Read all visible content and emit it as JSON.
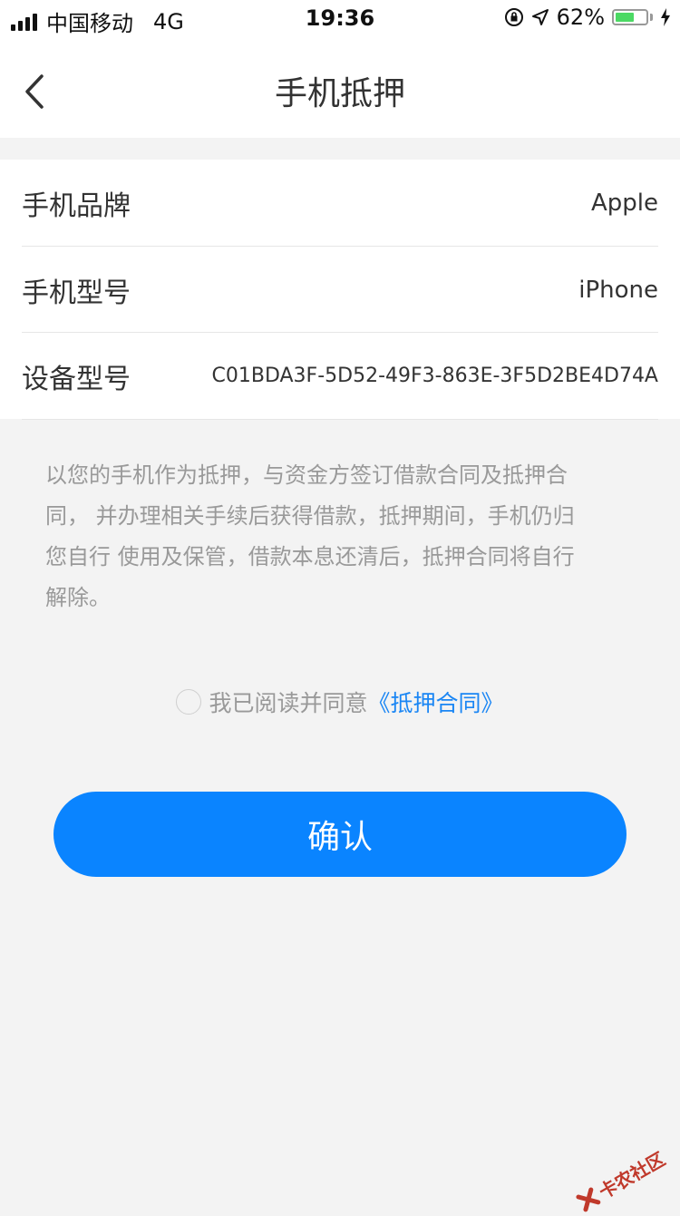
{
  "status_bar": {
    "carrier": "中国移动",
    "network": "4G",
    "time": "19:36",
    "battery_percent_label": "62%",
    "battery_level": 0.62,
    "battery_color": "#4cd964"
  },
  "nav": {
    "title": "手机抵押",
    "back_icon": "chevron-left-icon"
  },
  "info_rows": [
    {
      "label": "手机品牌",
      "value": "Apple"
    },
    {
      "label": "手机型号",
      "value": "iPhone"
    },
    {
      "label": "设备型号",
      "value": "C01BDA3F-5D52-49F3-863E-3F5D2BE4D74A"
    }
  ],
  "notice": {
    "line1": "以您的手机作为抵押，与资金方签订借款合同及抵押合",
    "line2": "同， 并办理相关手续后获得借款，抵押期间，手机仍归",
    "line3": "您自行 使用及保管，借款本息还清后，抵押合同将自行",
    "line4": "解除。"
  },
  "agreement": {
    "text": "我已阅读并同意",
    "link": "《抵押合同》",
    "checked": false
  },
  "confirm_button": {
    "label": "确认",
    "color": "#0a84ff"
  },
  "watermark": {
    "text": "卡农社区"
  }
}
